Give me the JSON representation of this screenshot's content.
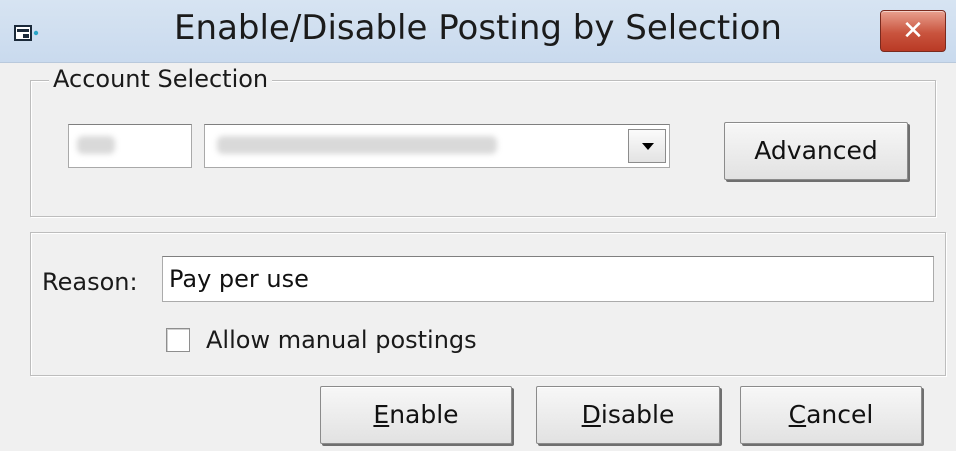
{
  "window": {
    "title": "Enable/Disable Posting by Selection",
    "close_glyph": "✕",
    "icon": "app-window-icon"
  },
  "account_selection": {
    "legend": "Account Selection",
    "account_code_value": "(blurred)",
    "account_name_value": "(blurred)",
    "advanced_label": "Advanced"
  },
  "reason_section": {
    "reason_label": "Reason:",
    "reason_value": "Pay per use",
    "allow_manual_label": "Allow manual postings",
    "allow_manual_checked": false
  },
  "buttons": {
    "enable": {
      "label": "Enable",
      "mnemonic": "E",
      "rest": "nable"
    },
    "disable": {
      "label": "Disable",
      "mnemonic": "D",
      "rest": "isable"
    },
    "cancel": {
      "label": "Cancel",
      "mnemonic": "C",
      "rest": "ancel"
    }
  },
  "colors": {
    "window_bg": "#f0f0f0",
    "titlebar": "#d0dfef",
    "close_button": "#c9543e"
  }
}
